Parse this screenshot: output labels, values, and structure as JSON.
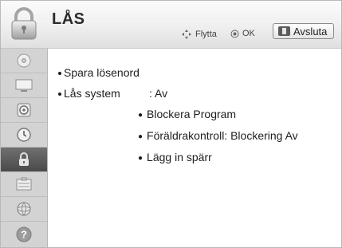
{
  "header": {
    "title": "LÅS",
    "icon": "lock-icon",
    "hint_move": "Flytta",
    "hint_ok": "OK",
    "exit_label": "Avsluta"
  },
  "sidebar": {
    "items": [
      {
        "icon": "disc-icon",
        "active": false
      },
      {
        "icon": "screen-icon",
        "active": false
      },
      {
        "icon": "speaker-icon",
        "active": false
      },
      {
        "icon": "clock-icon",
        "active": false
      },
      {
        "icon": "lock-icon",
        "active": true
      },
      {
        "icon": "options-icon",
        "active": false
      },
      {
        "icon": "network-icon",
        "active": false
      },
      {
        "icon": "help-icon",
        "active": false
      }
    ]
  },
  "menu": {
    "items": [
      {
        "label": "Spara lösenord"
      },
      {
        "label": "Lås system",
        "value": ": Av"
      }
    ],
    "subitems": [
      {
        "label": "Blockera Program"
      },
      {
        "label": "Föräldrakontroll: Blockering Av"
      },
      {
        "label": "Lägg in spärr"
      }
    ]
  },
  "colors": {
    "active_item": "#555555",
    "sidebar_bg": "#d3d3d3",
    "header_bg": "#efefef"
  }
}
